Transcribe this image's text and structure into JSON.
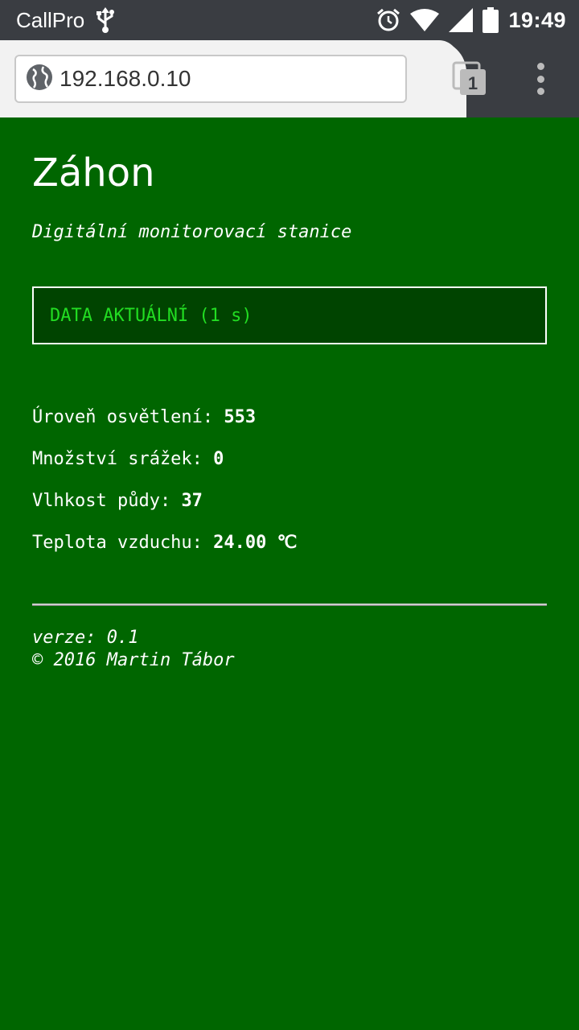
{
  "status_bar": {
    "carrier": "CallPro",
    "time": "19:49",
    "icons": [
      "usb-icon",
      "alarm-icon",
      "wifi-icon",
      "signal-icon",
      "battery-icon"
    ]
  },
  "browser": {
    "url": "192.168.0.10",
    "tab_count": "1",
    "icons": [
      "globe-icon",
      "tab-switcher-icon",
      "menu-icon"
    ]
  },
  "page": {
    "title": "Záhon",
    "subtitle": "Digitální monitorovací stanice",
    "status_box": "DATA AKTUÁLNÍ (1 s)",
    "readings": [
      {
        "label": "Úroveň osvětlení: ",
        "value": "553"
      },
      {
        "label": "Množství srážek: ",
        "value": "0"
      },
      {
        "label": "Vlhkost půdy: ",
        "value": "37"
      },
      {
        "label": "Teplota vzduchu: ",
        "value": "24.00 ℃"
      }
    ],
    "footer": {
      "version": "verze: 0.1",
      "copyright": "© 2016 Martin Tábor"
    }
  },
  "colors": {
    "page_background": "#006600",
    "status_box_background": "#004400",
    "status_text": "#22dd22",
    "chrome": "#3a3d42"
  }
}
